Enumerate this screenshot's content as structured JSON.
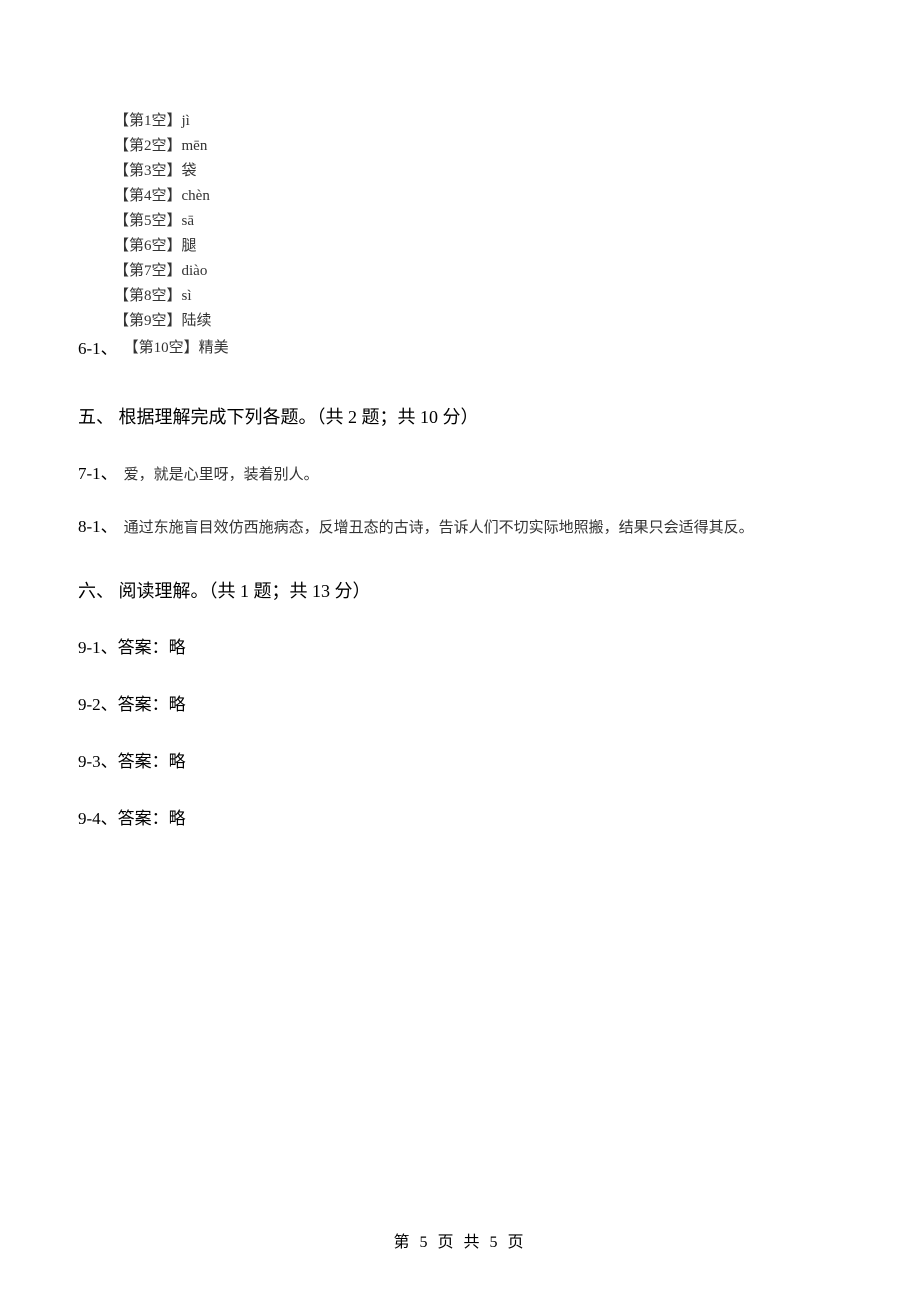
{
  "q6": {
    "num": "6-1、",
    "answers": [
      "【第1空】jì",
      "【第2空】mēn",
      "【第3空】袋",
      "【第4空】chèn",
      "【第5空】sā",
      "【第6空】腿",
      "【第7空】diào",
      "【第8空】sì",
      "【第9空】陆续",
      "【第10空】精美"
    ]
  },
  "section5": {
    "heading": "五、 根据理解完成下列各题。（共 2 题；共 10 分）",
    "items": [
      {
        "num": "7-1、",
        "text": "爱，就是心里呀，装着别人。"
      },
      {
        "num": "8-1、",
        "text": "通过东施盲目效仿西施病态，反增丑态的古诗，告诉人们不切实际地照搬，结果只会适得其反。"
      }
    ]
  },
  "section6": {
    "heading": "六、 阅读理解。（共 1 题；共 13 分）",
    "items": [
      {
        "num": "9-1、",
        "text": "答案：略"
      },
      {
        "num": "9-2、",
        "text": "答案：略"
      },
      {
        "num": "9-3、",
        "text": "答案：略"
      },
      {
        "num": "9-4、",
        "text": "答案：略"
      }
    ]
  },
  "footer": "第 5 页 共 5 页"
}
